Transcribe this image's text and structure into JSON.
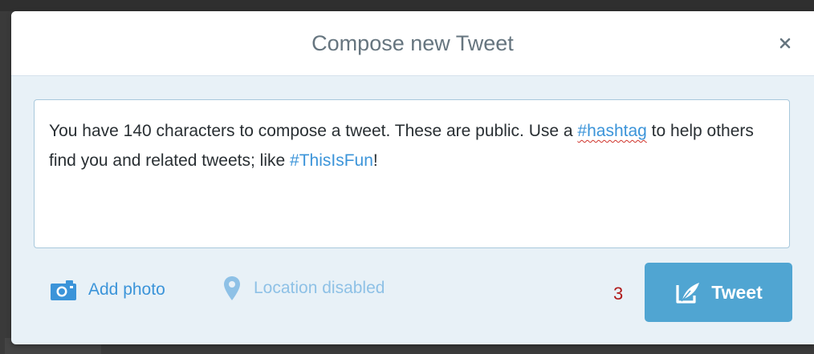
{
  "dialog": {
    "title": "Compose new Tweet",
    "close_icon": "close-icon"
  },
  "composer": {
    "segments": [
      {
        "text": "You have 140 characters to compose a tweet. These are public. Use a ",
        "kind": "plain"
      },
      {
        "text": "#hashtag",
        "kind": "hashtag",
        "misspelled": true
      },
      {
        "text": " to help others find you and related tweets; like ",
        "kind": "plain"
      },
      {
        "text": "#ThisIsFun",
        "kind": "hashtag",
        "misspelled": false
      },
      {
        "text": "!",
        "kind": "plain"
      }
    ]
  },
  "toolbar": {
    "add_photo_label": "Add photo",
    "add_photo_icon": "camera-icon",
    "location_label": "Location disabled",
    "location_icon": "location-pin-icon"
  },
  "counter": {
    "remaining": "3"
  },
  "tweet_button": {
    "label": "Tweet",
    "icon": "compose-quill-icon"
  },
  "colors": {
    "accent": "#3b94d9",
    "button": "#50a5d2",
    "counter_warning": "#b01a1a",
    "title": "#66757f",
    "panel": "#e8f1f7"
  }
}
